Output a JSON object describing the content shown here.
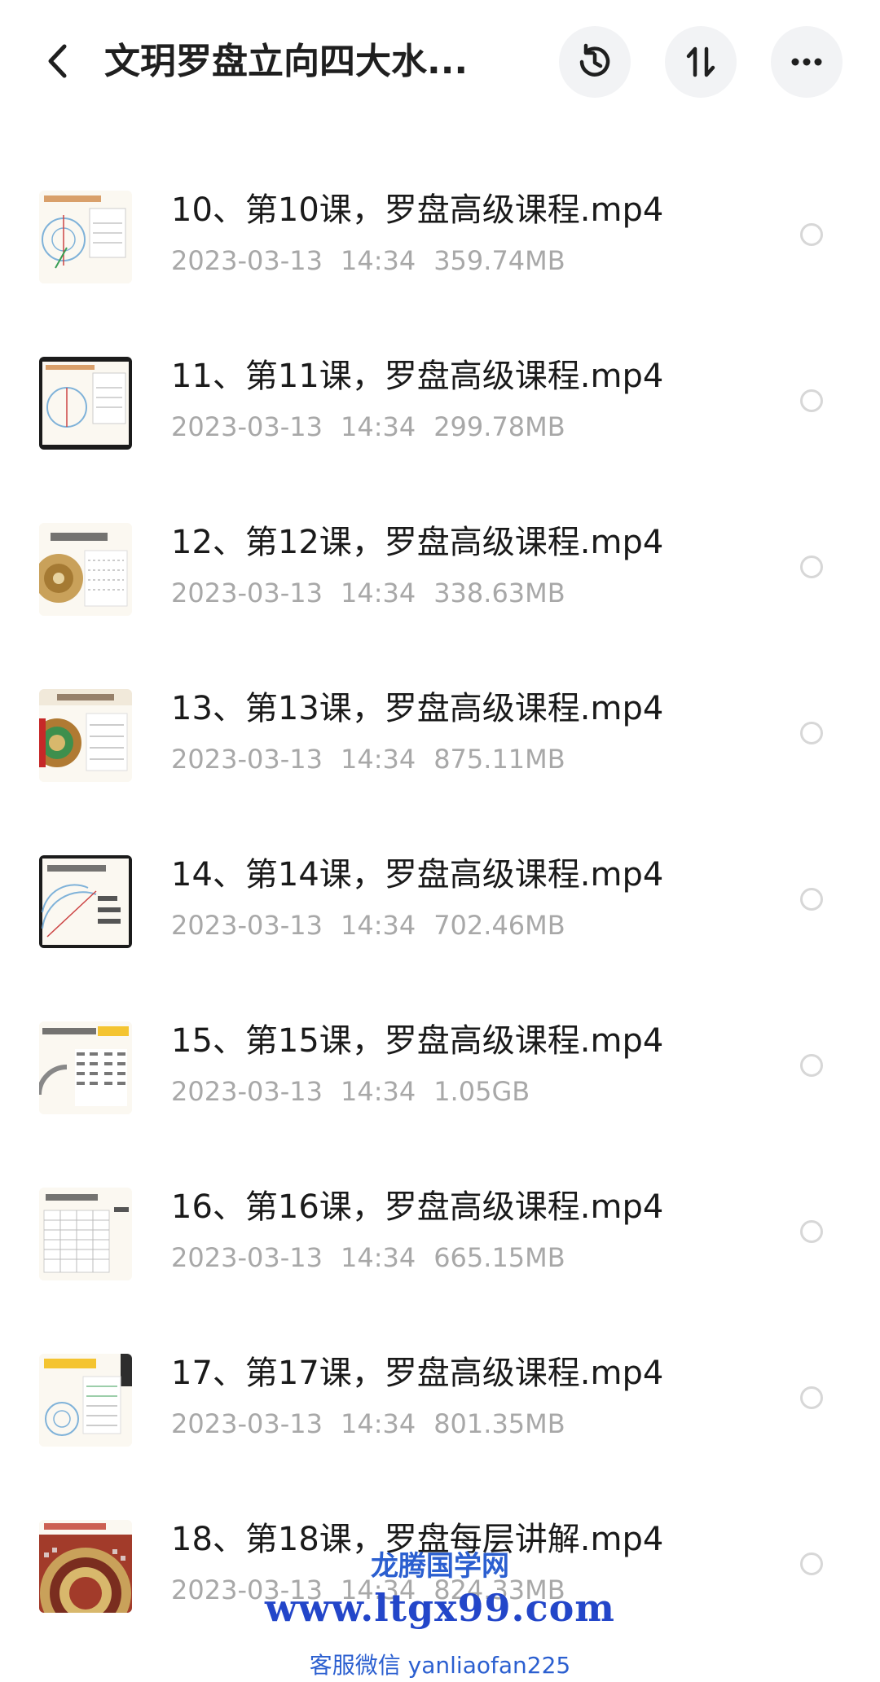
{
  "header": {
    "title": "文玥罗盘立向四大水...",
    "back_icon": "chevron-left-icon",
    "history_icon": "history-icon",
    "sort_icon": "sort-icon",
    "more_icon": "more-horizontal-icon"
  },
  "files": [
    {
      "name": "10、第10课，罗盘高级课程.mp4",
      "date": "2023-03-13",
      "time": "14:34",
      "size": "359.74MB"
    },
    {
      "name": "11、第11课，罗盘高级课程.mp4",
      "date": "2023-03-13",
      "time": "14:34",
      "size": "299.78MB"
    },
    {
      "name": "12、第12课，罗盘高级课程.mp4",
      "date": "2023-03-13",
      "time": "14:34",
      "size": "338.63MB"
    },
    {
      "name": "13、第13课，罗盘高级课程.mp4",
      "date": "2023-03-13",
      "time": "14:34",
      "size": "875.11MB"
    },
    {
      "name": "14、第14课，罗盘高级课程.mp4",
      "date": "2023-03-13",
      "time": "14:34",
      "size": "702.46MB"
    },
    {
      "name": "15、第15课，罗盘高级课程.mp4",
      "date": "2023-03-13",
      "time": "14:34",
      "size": "1.05GB"
    },
    {
      "name": "16、第16课，罗盘高级课程.mp4",
      "date": "2023-03-13",
      "time": "14:34",
      "size": "665.15MB"
    },
    {
      "name": "17、第17课，罗盘高级课程.mp4",
      "date": "2023-03-13",
      "time": "14:34",
      "size": "801.35MB"
    },
    {
      "name": "18、第18课，罗盘每层讲解.mp4",
      "date": "2023-03-13",
      "time": "14:34",
      "size": "824.33MB"
    }
  ],
  "watermark": {
    "site_name": "龙腾国学网",
    "url": "www.ltgx99.com",
    "wechat": "客服微信 yanliaofan225"
  },
  "colors": {
    "title": "#1f1f1f",
    "meta": "#a8a8a8",
    "button_bg": "#f2f3f5",
    "watermark": "#2346c9"
  }
}
